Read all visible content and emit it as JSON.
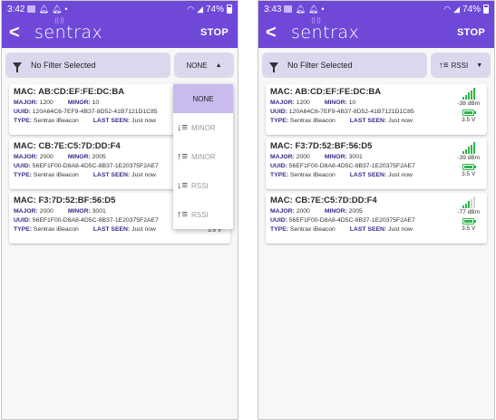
{
  "app": {
    "logo_text": "sentrax",
    "logo_wave": "((·))",
    "stop_label": "STOP",
    "back_glyph": "<"
  },
  "colors": {
    "primary": "#7048d8",
    "filter_bg": "#ddd7ee",
    "selected_option": "#c9bbee",
    "signal_green": "#2fb64a"
  },
  "left": {
    "status": {
      "time": "3:42",
      "battery": "74%"
    },
    "filter_label": "No Filter Selected",
    "sort_label": "NONE",
    "sort_caret": "▲",
    "devices": [
      {
        "mac": "AB:CD:EF:FE:DC:BA",
        "major": "1200",
        "minor": "10",
        "uuid": "120A64C6-7EF9-4B37-8D52-41B7121D1C85",
        "type": "Sentrax iBeacon",
        "last_seen": "Just now"
      },
      {
        "mac": "CB:7E:C5:7D:DD:F4",
        "major": "2000",
        "minor": "2005",
        "uuid": "56EF1F00-D8A8-4D5C-8B37-1E20375F2AE7",
        "type": "Sentrax iBeacon",
        "last_seen": "Just now"
      },
      {
        "mac": "F3:7D:52:BF:56:D5",
        "major": "2000",
        "minor": "3001",
        "uuid": "56EF1F00-D8A8-4D5C-8B37-1E20375F2AE7",
        "type": "Sentrax iBeacon",
        "last_seen": "Just now"
      }
    ],
    "partial_voltage": "3.5 V",
    "dropdown": [
      {
        "label": "NONE",
        "icon": "",
        "icon_name": "none",
        "selected": true
      },
      {
        "label": "MINOR",
        "icon": "↓≡",
        "icon_name": "sort-desc-icon",
        "selected": false
      },
      {
        "label": "MINOR",
        "icon": "↑≡",
        "icon_name": "sort-asc-icon",
        "selected": false
      },
      {
        "label": "RSSI",
        "icon": "↓≡",
        "icon_name": "sort-desc-icon",
        "selected": false
      },
      {
        "label": "RSSI",
        "icon": "↑≡",
        "icon_name": "sort-asc-icon",
        "selected": false
      }
    ]
  },
  "right": {
    "status": {
      "time": "3:43",
      "battery": "74%"
    },
    "filter_label": "No Filter Selected",
    "sort_icon": "↑≡",
    "sort_label": "RSSI",
    "sort_caret": "▼",
    "devices": [
      {
        "mac": "AB:CD:EF:FE:DC:BA",
        "major": "1200",
        "minor": "10",
        "uuid": "120A64C6-7EF9-4B37-8D52-41B7121D1C85",
        "type": "Sentrax iBeacon",
        "last_seen": "Just now",
        "rssi": "-38 dBm",
        "signal_bars": 5,
        "voltage": "3.5 V"
      },
      {
        "mac": "F3:7D:52:BF:56:D5",
        "major": "2000",
        "minor": "3001",
        "uuid": "56EF1F00-D8A8-4D5C-8B37-1E20375F2AE7",
        "type": "Sentrax iBeacon",
        "last_seen": "Just now",
        "rssi": "-39 dBm",
        "signal_bars": 5,
        "voltage": "3.5 V"
      },
      {
        "mac": "CB:7E:C5:7D:DD:F4",
        "major": "2000",
        "minor": "2005",
        "uuid": "56EF1F00-D8A8-4D5C-8B37-1E20375F2AE7",
        "type": "Sentrax iBeacon",
        "last_seen": "Just now",
        "rssi": "-77 dBm",
        "signal_bars": 3,
        "voltage": "3.5 V"
      }
    ]
  },
  "labels": {
    "mac": "MAC:",
    "major": "MAJOR:",
    "minor": "MINOR:",
    "uuid": "UUID:",
    "type": "TYPE:",
    "last_seen": "LAST SEEN:"
  }
}
